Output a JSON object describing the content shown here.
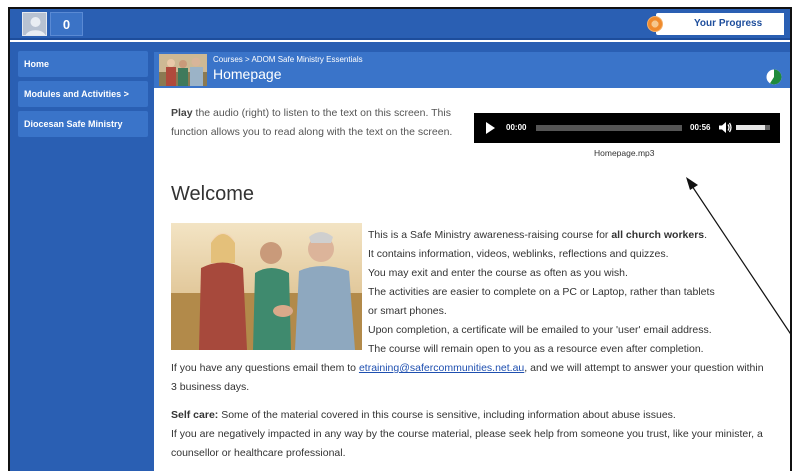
{
  "topbar": {
    "notification_count": "0",
    "progress_label": "Your Progress"
  },
  "sidebar": {
    "items": [
      {
        "label": "Home"
      },
      {
        "label": "Modules and Activities >"
      },
      {
        "label": "Diocesan Safe Ministry"
      }
    ]
  },
  "header": {
    "breadcrumb": "Courses > ADOM Safe Ministry Essentials",
    "title": "Homepage"
  },
  "intro": {
    "bold": "Play",
    "rest": " the audio (right) to listen to the text on this screen. This function allows you to read along with the text on the screen."
  },
  "audio": {
    "current_time": "00:00",
    "duration": "00:56",
    "filename": "Homepage.mp3",
    "progress": 0,
    "volume": 0.85
  },
  "welcome": {
    "heading": "Welcome",
    "line1_pre": "This is a Safe Ministry awareness-raising course for ",
    "line1_bold": "all church workers",
    "line1_post": ".",
    "lines": [
      "It contains information, videos, weblinks, reflections and quizzes.",
      "You may exit and enter the course as often as you wish.",
      "The activities are easier to complete on a PC  or Laptop, rather than tablets",
      "or smart phones.",
      "Upon completion, a certificate will be emailed to your 'user' email address.",
      "The course will remain open to you as a resource even after completion."
    ]
  },
  "contact": {
    "pre": "If you have any questions email them to ",
    "email": "etraining@safercommunities.net.au",
    "post": ", and we will attempt to answer your question within 3 business days."
  },
  "selfcare": {
    "bold": "Self care:",
    "line1": " Some of the material covered in this course is sensitive, including information about abuse issues.",
    "line2": "If you are negatively impacted in any way by the course material, please seek help from someone you trust, like your minister, a counsellor or healthcare professional."
  },
  "colors": {
    "brand_blue": "#2a5fb3",
    "nav_blue": "#3a74c9",
    "progress_orange": "#f08a2c",
    "link": "#1e4fb0"
  }
}
